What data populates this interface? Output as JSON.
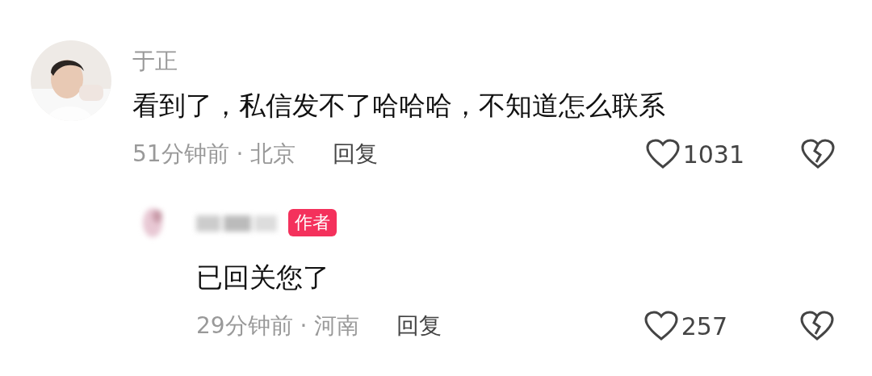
{
  "comments": [
    {
      "kind": "comment",
      "name": "于正",
      "text": "看到了，私信发不了哈哈哈，不知道怎么联系",
      "time": "51分钟前 · 北京",
      "reply": "回复",
      "likes": "1031"
    },
    {
      "kind": "reply",
      "avatar": {
        "kind": "blurred"
      },
      "badge": "作者",
      "text": "已回关您了",
      "time": "29分钟前 · 河南",
      "reply": "回复",
      "likes": "257"
    }
  ]
}
